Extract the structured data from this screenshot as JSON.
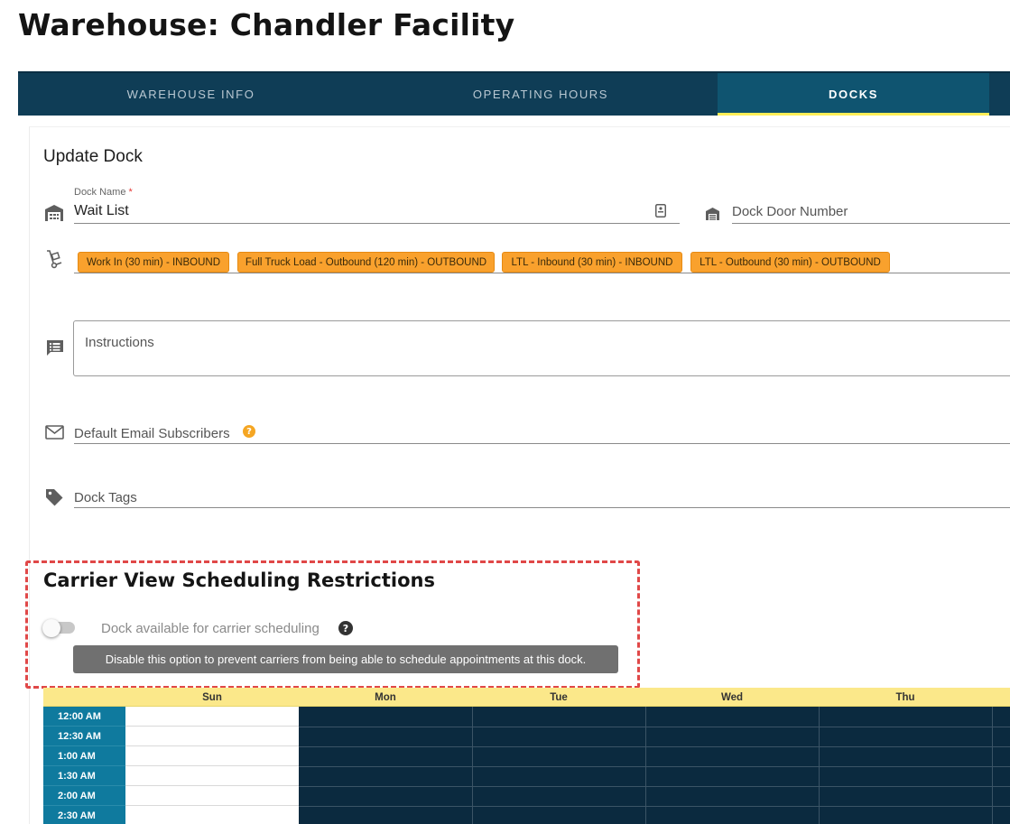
{
  "page": {
    "title": "Warehouse: Chandler Facility"
  },
  "tabs": [
    {
      "label": "WAREHOUSE INFO",
      "active": false
    },
    {
      "label": "OPERATING HOURS",
      "active": false
    },
    {
      "label": "DOCKS",
      "active": true
    }
  ],
  "form": {
    "title": "Update Dock",
    "dock_name": {
      "label": "Dock Name",
      "required_mark": "*",
      "value": "Wait List"
    },
    "dock_door_number": {
      "placeholder": "Dock Door Number"
    },
    "load_types": [
      "Work In (30 min) - INBOUND",
      "Full Truck Load - Outbound (120 min) - OUTBOUND",
      "LTL - Inbound (30 min) - INBOUND",
      "LTL - Outbound (30 min) - OUTBOUND"
    ],
    "instructions": {
      "label": "Instructions"
    },
    "email_subscribers": {
      "label": "Default Email Subscribers",
      "help": "?"
    },
    "dock_tags": {
      "label": "Dock Tags"
    }
  },
  "restrictions": {
    "title": "Carrier View Scheduling Restrictions",
    "toggle_label": "Dock available for carrier scheduling",
    "toggle_on": false,
    "help": "?",
    "tooltip": "Disable this option to prevent carriers from being able to schedule appointments at this dock."
  },
  "schedule": {
    "days": [
      "Sun",
      "Mon",
      "Tue",
      "Wed",
      "Thu"
    ],
    "times": [
      "12:00 AM",
      "12:30 AM",
      "1:00 AM",
      "1:30 AM",
      "2:00 AM",
      "2:30 AM"
    ]
  },
  "colors": {
    "tabbar": "#0f3d56",
    "active_tab": "#0f5470",
    "active_indicator": "#ffee58",
    "chip": "#f9a12d",
    "highlight_box": "#e04848",
    "grid_header": "#fbe88a",
    "time_column": "#0f7a9e",
    "closed_cell": "#0b2a3f"
  },
  "icons": {
    "dock_name": "warehouse-icon",
    "dock_name_action": "id-card-icon",
    "dock_door": "garage-door-icon",
    "load_types": "hand-truck-icon",
    "instructions": "notes-icon",
    "email": "mail-icon",
    "tags": "tag-icon"
  }
}
